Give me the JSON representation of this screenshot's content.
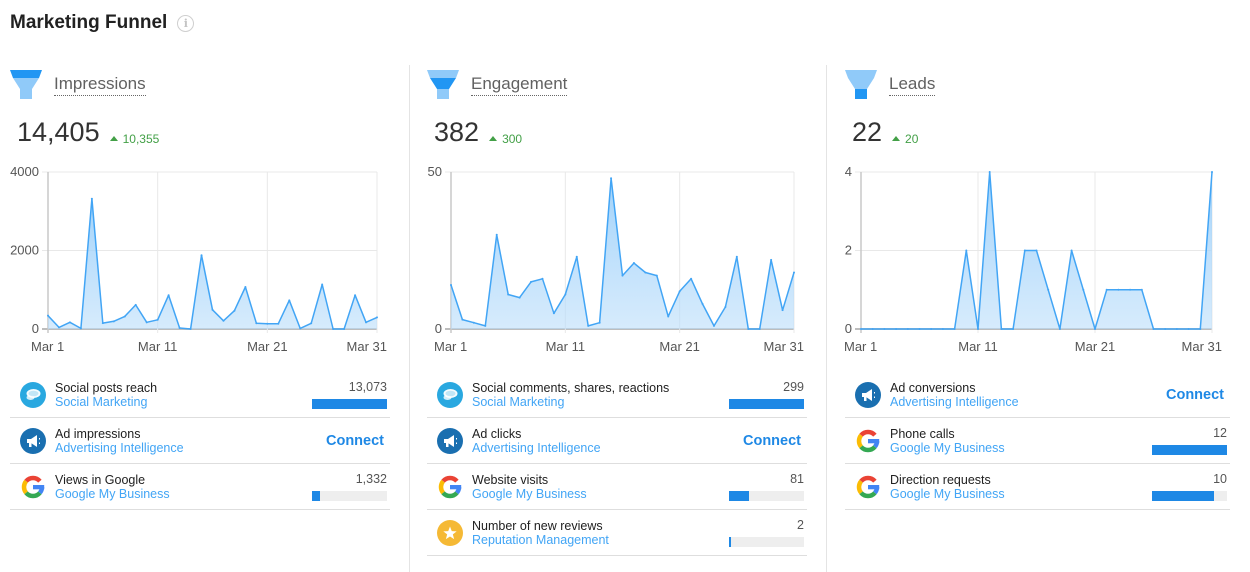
{
  "page": {
    "title": "Marketing Funnel",
    "info_icon": "info-circle-icon"
  },
  "columns": [
    {
      "key": "impressions",
      "label": "Impressions",
      "icon": "funnel-top-icon",
      "total": "14,405",
      "delta": "10,355",
      "delta_direction": "up",
      "items": [
        {
          "title": "Social posts reach",
          "source": "Social Marketing",
          "icon": "social-marketing-icon",
          "value": "13,073",
          "bar_fraction": 1.0,
          "connect": null
        },
        {
          "title": "Ad impressions",
          "source": "Advertising Intelligence",
          "icon": "megaphone-icon",
          "value": null,
          "bar_fraction": null,
          "connect": "Connect"
        },
        {
          "title": "Views in Google",
          "source": "Google My Business",
          "icon": "google-icon",
          "value": "1,332",
          "bar_fraction": 0.102,
          "connect": null
        }
      ]
    },
    {
      "key": "engagement",
      "label": "Engagement",
      "icon": "funnel-middle-icon",
      "total": "382",
      "delta": "300",
      "delta_direction": "up",
      "items": [
        {
          "title": "Social comments, shares, reactions",
          "source": "Social Marketing",
          "icon": "social-marketing-icon",
          "value": "299",
          "bar_fraction": 1.0,
          "connect": null
        },
        {
          "title": "Ad clicks",
          "source": "Advertising Intelligence",
          "icon": "megaphone-icon",
          "value": null,
          "bar_fraction": null,
          "connect": "Connect"
        },
        {
          "title": "Website visits",
          "source": "Google My Business",
          "icon": "google-icon",
          "value": "81",
          "bar_fraction": 0.271,
          "connect": null
        },
        {
          "title": "Number of new reviews",
          "source": "Reputation Management",
          "icon": "star-icon",
          "value": "2",
          "bar_fraction": 0.007,
          "connect": null
        }
      ]
    },
    {
      "key": "leads",
      "label": "Leads",
      "icon": "funnel-bottom-icon",
      "total": "22",
      "delta": "20",
      "delta_direction": "up",
      "items": [
        {
          "title": "Ad conversions",
          "source": "Advertising Intelligence",
          "icon": "megaphone-icon",
          "value": null,
          "bar_fraction": null,
          "connect": "Connect"
        },
        {
          "title": "Phone calls",
          "source": "Google My Business",
          "icon": "google-icon",
          "value": "12",
          "bar_fraction": 1.0,
          "connect": null
        },
        {
          "title": "Direction requests",
          "source": "Google My Business",
          "icon": "google-icon",
          "value": "10",
          "bar_fraction": 0.833,
          "connect": null
        }
      ]
    }
  ],
  "colors": {
    "accent": "#1e88e5",
    "line": "#42a5f5",
    "area": "#bbdefb",
    "positive": "#43a047",
    "funnel_dark": "#2196f3",
    "funnel_light": "#90caf9",
    "social_icon": "#29a8e0",
    "ad_icon": "#1a6fb0",
    "star_icon": "#f5b935"
  },
  "chart_data": [
    {
      "type": "area",
      "title": "Impressions",
      "x": [
        "Mar 1",
        "Mar 2",
        "Mar 3",
        "Mar 4",
        "Mar 5",
        "Mar 6",
        "Mar 7",
        "Mar 8",
        "Mar 9",
        "Mar 10",
        "Mar 11",
        "Mar 12",
        "Mar 13",
        "Mar 14",
        "Mar 15",
        "Mar 16",
        "Mar 17",
        "Mar 18",
        "Mar 19",
        "Mar 20",
        "Mar 21",
        "Mar 22",
        "Mar 23",
        "Mar 24",
        "Mar 25",
        "Mar 26",
        "Mar 27",
        "Mar 28",
        "Mar 29",
        "Mar 30",
        "Mar 31"
      ],
      "values": [
        340,
        40,
        170,
        15,
        3320,
        150,
        195,
        320,
        615,
        170,
        235,
        860,
        25,
        0,
        1880,
        490,
        210,
        465,
        1070,
        145,
        135,
        135,
        730,
        15,
        145,
        1135,
        0,
        0,
        860,
        170,
        295
      ],
      "x_ticks": [
        "Mar 1",
        "Mar 11",
        "Mar 21",
        "Mar 31"
      ],
      "y_ticks": [
        0,
        2000,
        4000
      ],
      "ylim": [
        0,
        4000
      ],
      "grid": true
    },
    {
      "type": "area",
      "title": "Engagement",
      "x": [
        "Mar 1",
        "Mar 2",
        "Mar 3",
        "Mar 4",
        "Mar 5",
        "Mar 6",
        "Mar 7",
        "Mar 8",
        "Mar 9",
        "Mar 10",
        "Mar 11",
        "Mar 12",
        "Mar 13",
        "Mar 14",
        "Mar 15",
        "Mar 16",
        "Mar 17",
        "Mar 18",
        "Mar 19",
        "Mar 20",
        "Mar 21",
        "Mar 22",
        "Mar 23",
        "Mar 24",
        "Mar 25",
        "Mar 26",
        "Mar 27",
        "Mar 28",
        "Mar 29",
        "Mar 30",
        "Mar 31"
      ],
      "values": [
        14,
        3,
        2,
        1,
        30,
        11,
        10,
        15,
        16,
        5,
        11,
        23,
        1,
        2,
        48,
        17,
        21,
        18,
        17,
        4,
        12,
        16,
        8,
        1,
        7,
        23,
        0,
        0,
        22,
        6,
        18
      ],
      "x_ticks": [
        "Mar 1",
        "Mar 11",
        "Mar 21",
        "Mar 31"
      ],
      "y_ticks": [
        0,
        50
      ],
      "ylim": [
        0,
        50
      ],
      "grid": true
    },
    {
      "type": "area",
      "title": "Leads",
      "x": [
        "Mar 1",
        "Mar 2",
        "Mar 3",
        "Mar 4",
        "Mar 5",
        "Mar 6",
        "Mar 7",
        "Mar 8",
        "Mar 9",
        "Mar 10",
        "Mar 11",
        "Mar 12",
        "Mar 13",
        "Mar 14",
        "Mar 15",
        "Mar 16",
        "Mar 17",
        "Mar 18",
        "Mar 19",
        "Mar 20",
        "Mar 21",
        "Mar 22",
        "Mar 23",
        "Mar 24",
        "Mar 25",
        "Mar 26",
        "Mar 27",
        "Mar 28",
        "Mar 29",
        "Mar 30",
        "Mar 31"
      ],
      "values": [
        0,
        0,
        0,
        0,
        0,
        0,
        0,
        0,
        0,
        2,
        0,
        4,
        0,
        0,
        2,
        2,
        1,
        0,
        2,
        1,
        0,
        1,
        1,
        1,
        1,
        0,
        0,
        0,
        0,
        0,
        4
      ],
      "x_ticks": [
        "Mar 1",
        "Mar 11",
        "Mar 21",
        "Mar 31"
      ],
      "y_ticks": [
        0,
        2,
        4
      ],
      "ylim": [
        0,
        4
      ],
      "grid": true
    }
  ]
}
